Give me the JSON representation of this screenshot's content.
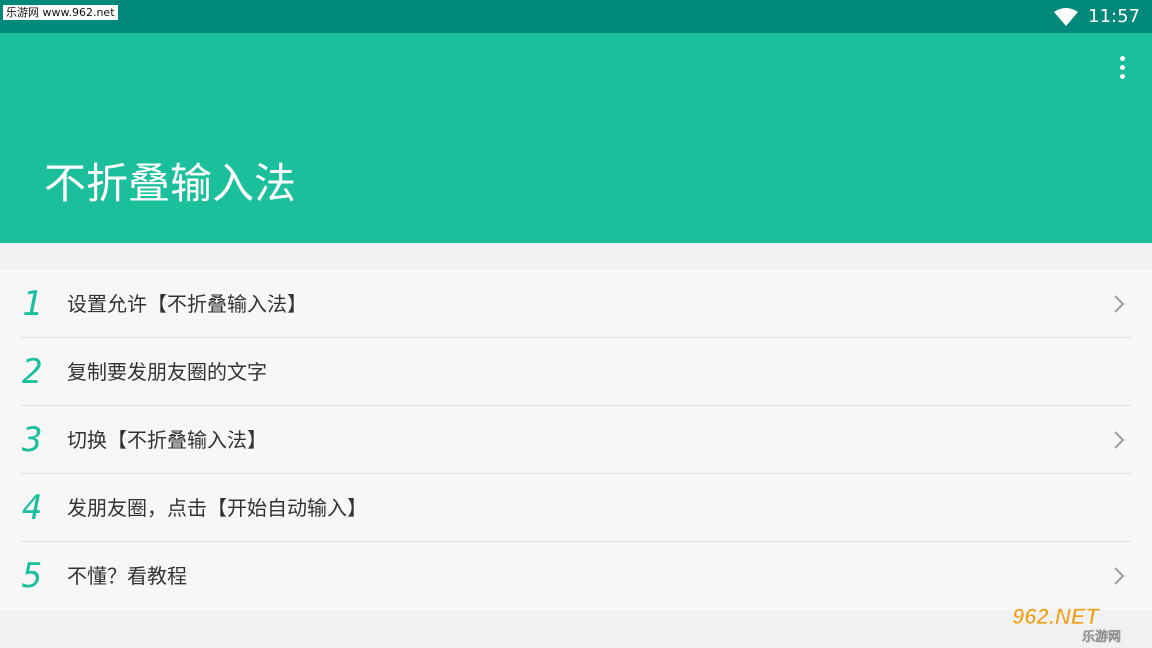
{
  "status_bar": {
    "watermark": "乐游网 www.962.net",
    "time": "11:57",
    "wifi_icon": "wifi-icon"
  },
  "app_bar": {
    "title": "不折叠输入法",
    "menu_icon": "more-vert-icon"
  },
  "steps": [
    {
      "number": "1",
      "label": "设置允许【不折叠输入法】",
      "has_chevron": true
    },
    {
      "number": "2",
      "label": "复制要发朋友圈的文字",
      "has_chevron": false
    },
    {
      "number": "3",
      "label": "切换【不折叠输入法】",
      "has_chevron": true
    },
    {
      "number": "4",
      "label": "发朋友圈，点击【开始自动输入】",
      "has_chevron": false
    },
    {
      "number": "5",
      "label": "不懂？看教程",
      "has_chevron": true
    }
  ],
  "watermark_logo": {
    "brand": "962.NET",
    "tagline": "乐游网"
  },
  "colors": {
    "status_bar": "#00897b",
    "app_bar": "#1bbf9b",
    "accent": "#1bbf9b"
  }
}
